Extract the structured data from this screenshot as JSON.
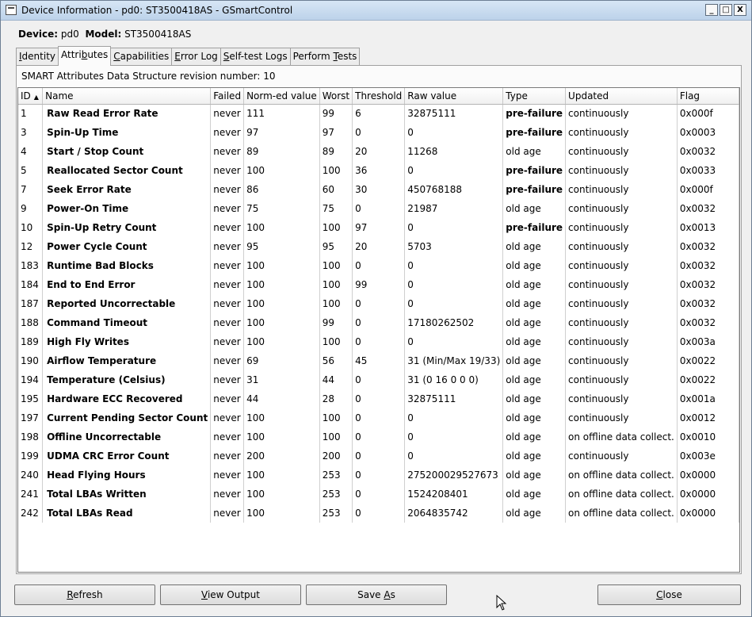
{
  "window": {
    "title": "Device Information - pd0: ST3500418AS - GSmartControl",
    "minimize_glyph": "_",
    "maximize_glyph": "□",
    "close_glyph": "X"
  },
  "device": {
    "device_label": "Device:",
    "device_value": "pd0",
    "model_label": "Model:",
    "model_value": "ST3500418AS"
  },
  "tabs": [
    {
      "pre": "",
      "key": "I",
      "post": "dentity"
    },
    {
      "pre": "Attri",
      "key": "b",
      "post": "utes"
    },
    {
      "pre": "",
      "key": "C",
      "post": "apabilities"
    },
    {
      "pre": "",
      "key": "E",
      "post": "rror Log"
    },
    {
      "pre": "",
      "key": "S",
      "post": "elf-test Logs"
    },
    {
      "pre": "Perform ",
      "key": "T",
      "post": "ests"
    }
  ],
  "active_tab": 1,
  "revision_line": "SMART Attributes Data Structure revision number: 10",
  "table": {
    "columns": [
      "ID",
      "Name",
      "Failed",
      "Norm-ed value",
      "Worst",
      "Threshold",
      "Raw value",
      "Type",
      "Updated",
      "Flag"
    ],
    "rows": [
      [
        "1",
        "Raw Read Error Rate",
        "never",
        "111",
        "99",
        "6",
        "32875111",
        "pre-failure",
        "continuously",
        "0x000f"
      ],
      [
        "3",
        "Spin-Up Time",
        "never",
        "97",
        "97",
        "0",
        "0",
        "pre-failure",
        "continuously",
        "0x0003"
      ],
      [
        "4",
        "Start / Stop Count",
        "never",
        "89",
        "89",
        "20",
        "11268",
        "old age",
        "continuously",
        "0x0032"
      ],
      [
        "5",
        "Reallocated Sector Count",
        "never",
        "100",
        "100",
        "36",
        "0",
        "pre-failure",
        "continuously",
        "0x0033"
      ],
      [
        "7",
        "Seek Error Rate",
        "never",
        "86",
        "60",
        "30",
        "450768188",
        "pre-failure",
        "continuously",
        "0x000f"
      ],
      [
        "9",
        "Power-On Time",
        "never",
        "75",
        "75",
        "0",
        "21987",
        "old age",
        "continuously",
        "0x0032"
      ],
      [
        "10",
        "Spin-Up Retry Count",
        "never",
        "100",
        "100",
        "97",
        "0",
        "pre-failure",
        "continuously",
        "0x0013"
      ],
      [
        "12",
        "Power Cycle Count",
        "never",
        "95",
        "95",
        "20",
        "5703",
        "old age",
        "continuously",
        "0x0032"
      ],
      [
        "183",
        "Runtime Bad Blocks",
        "never",
        "100",
        "100",
        "0",
        "0",
        "old age",
        "continuously",
        "0x0032"
      ],
      [
        "184",
        "End to End Error",
        "never",
        "100",
        "100",
        "99",
        "0",
        "old age",
        "continuously",
        "0x0032"
      ],
      [
        "187",
        "Reported Uncorrectable",
        "never",
        "100",
        "100",
        "0",
        "0",
        "old age",
        "continuously",
        "0x0032"
      ],
      [
        "188",
        "Command Timeout",
        "never",
        "100",
        "99",
        "0",
        "17180262502",
        "old age",
        "continuously",
        "0x0032"
      ],
      [
        "189",
        "High Fly Writes",
        "never",
        "100",
        "100",
        "0",
        "0",
        "old age",
        "continuously",
        "0x003a"
      ],
      [
        "190",
        "Airflow Temperature",
        "never",
        "69",
        "56",
        "45",
        "31 (Min/Max 19/33)",
        "old age",
        "continuously",
        "0x0022"
      ],
      [
        "194",
        "Temperature (Celsius)",
        "never",
        "31",
        "44",
        "0",
        "31 (0 16 0 0 0)",
        "old age",
        "continuously",
        "0x0022"
      ],
      [
        "195",
        "Hardware ECC Recovered",
        "never",
        "44",
        "28",
        "0",
        "32875111",
        "old age",
        "continuously",
        "0x001a"
      ],
      [
        "197",
        "Current Pending Sector Count",
        "never",
        "100",
        "100",
        "0",
        "0",
        "old age",
        "continuously",
        "0x0012"
      ],
      [
        "198",
        "Offline Uncorrectable",
        "never",
        "100",
        "100",
        "0",
        "0",
        "old age",
        "on offline data collect.",
        "0x0010"
      ],
      [
        "199",
        "UDMA CRC Error Count",
        "never",
        "200",
        "200",
        "0",
        "0",
        "old age",
        "continuously",
        "0x003e"
      ],
      [
        "240",
        "Head Flying Hours",
        "never",
        "100",
        "253",
        "0",
        "275200029527673",
        "old age",
        "on offline data collect.",
        "0x0000"
      ],
      [
        "241",
        "Total LBAs Written",
        "never",
        "100",
        "253",
        "0",
        "1524208401",
        "old age",
        "on offline data collect.",
        "0x0000"
      ],
      [
        "242",
        "Total LBAs Read",
        "never",
        "100",
        "253",
        "0",
        "2064835742",
        "old age",
        "on offline data collect.",
        "0x0000"
      ]
    ]
  },
  "buttons": {
    "refresh": {
      "pre": "",
      "key": "R",
      "post": "efresh"
    },
    "view_output": {
      "pre": "",
      "key": "V",
      "post": "iew Output"
    },
    "save_as": {
      "pre": "Save ",
      "key": "A",
      "post": "s"
    },
    "close": {
      "pre": "",
      "key": "C",
      "post": "lose"
    }
  }
}
